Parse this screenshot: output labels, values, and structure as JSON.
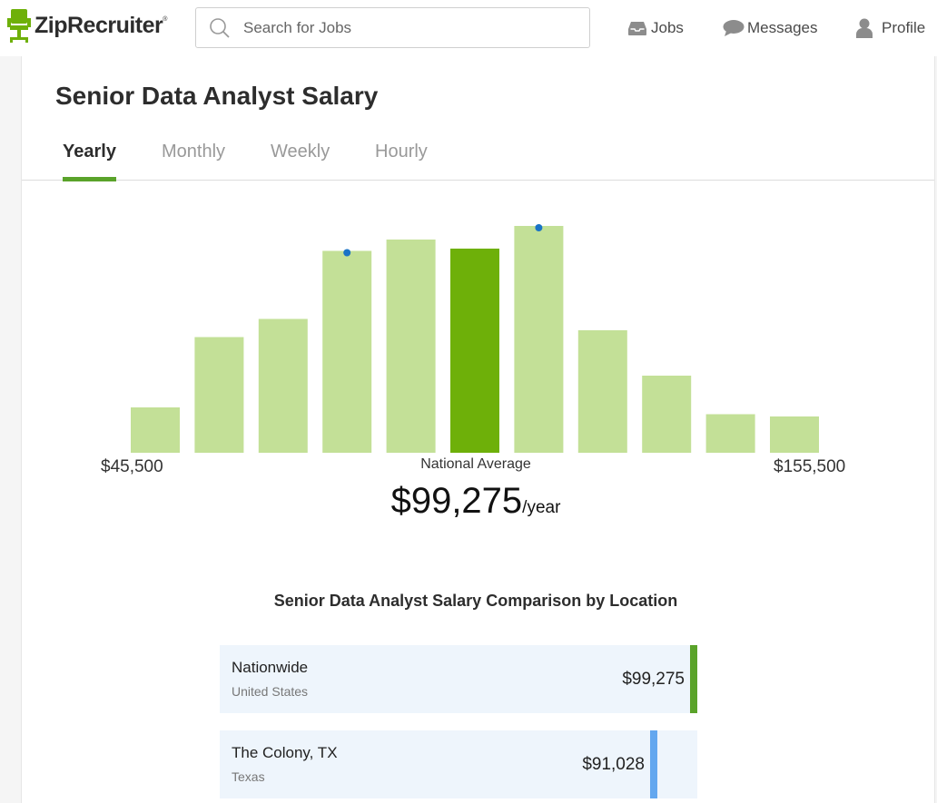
{
  "header": {
    "logo_text": "ZipRecruiter",
    "logo_mark": "®",
    "search_placeholder": "Search for Jobs",
    "nav": [
      {
        "label": "Jobs",
        "icon": "inbox-icon"
      },
      {
        "label": "Messages",
        "icon": "speech-bubble-icon"
      },
      {
        "label": "Profile",
        "icon": "person-icon"
      }
    ]
  },
  "page": {
    "title": "Senior Data Analyst Salary",
    "tabs": [
      "Yearly",
      "Monthly",
      "Weekly",
      "Hourly"
    ],
    "active_tab": "Yearly"
  },
  "chart_data": {
    "type": "bar",
    "bin_heights_relative": [
      0.2,
      0.51,
      0.59,
      0.89,
      0.94,
      0.9,
      1.0,
      0.54,
      0.34,
      0.17,
      0.16
    ],
    "highlight_index": 5,
    "marker_indices": [
      3,
      6
    ],
    "x_min_label": "$45,500",
    "x_max_label": "$155,500",
    "colors": {
      "bar": "#c3e097",
      "highlight": "#6eb009",
      "marker": "#1a73c6"
    }
  },
  "national": {
    "label": "National Average",
    "value": "$99,275",
    "unit": "/year"
  },
  "comparison": {
    "title": "Senior Data Analyst Salary Comparison by Location",
    "rows": [
      {
        "name": "Nationwide",
        "sub": "United States",
        "value": "$99,275",
        "fill": 1.0,
        "color": "#5aa32a"
      },
      {
        "name": "The Colony, TX",
        "sub": "Texas",
        "value": "$91,028",
        "fill": 0.917,
        "color": "#63a7ef"
      }
    ]
  }
}
